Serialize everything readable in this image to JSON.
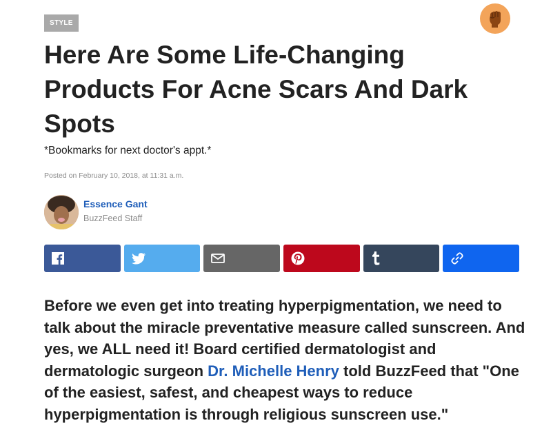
{
  "article": {
    "tag": "STYLE",
    "title": "Here Are Some Life-Changing Products For Acne Scars And Dark Spots",
    "dek": "*Bookmarks for next doctor's appt.*",
    "posted": "Posted on February 10, 2018, at 11:31 a.m."
  },
  "reaction": {
    "icon": "raised-fist-icon",
    "color": "#f3a45a"
  },
  "author": {
    "name": "Essence Gant",
    "role": "BuzzFeed Staff"
  },
  "share": [
    {
      "name": "facebook",
      "icon": "facebook-icon",
      "color": "#3b5998"
    },
    {
      "name": "twitter",
      "icon": "twitter-icon",
      "color": "#55acee"
    },
    {
      "name": "email",
      "icon": "email-icon",
      "color": "#666666"
    },
    {
      "name": "pinterest",
      "icon": "pinterest-icon",
      "color": "#bd081c"
    },
    {
      "name": "tumblr",
      "icon": "tumblr-icon",
      "color": "#35465c"
    },
    {
      "name": "copy-link",
      "icon": "link-icon",
      "color": "#0f65ef"
    }
  ],
  "body": {
    "before_link": "Before we even get into treating hyperpigmentation, we need to talk about the miracle preventative measure called sunscreen. And yes, we ALL need it! Board certified dermatologist and dermatologic surgeon ",
    "link_text": "Dr. Michelle Henry",
    "after_link": " told BuzzFeed that \"One of the easiest, safest, and cheapest ways to reduce hyperpigmentation is through religious sunscreen use.\""
  }
}
